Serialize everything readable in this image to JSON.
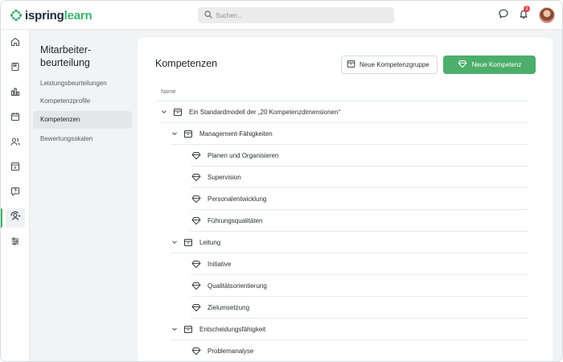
{
  "brand": {
    "part1": "ispring",
    "part2": "learn"
  },
  "search": {
    "placeholder": "Suchen..."
  },
  "notifications": {
    "count": "1"
  },
  "rail": {
    "icons": [
      "home-icon",
      "book-icon",
      "chart-icon",
      "calendar-icon",
      "users-icon",
      "archive-icon",
      "help-icon",
      "review-icon",
      "settings-icon"
    ],
    "active": "review-icon"
  },
  "subnav": {
    "title": "Mitarbeiter-beurteilung",
    "items": [
      {
        "label": "Leistungsbeurteilungen",
        "active": false
      },
      {
        "label": "Kompetenzprofile",
        "active": false
      },
      {
        "label": "Kompetenzen",
        "active": true
      },
      {
        "label": "Bewertungsskalen",
        "active": false
      }
    ]
  },
  "main": {
    "title": "Kompetenzen",
    "new_group_button": "Neue Kompetenzgruppe",
    "new_competency_button": "Neue Kompetenz",
    "accent_color": "#4cae6a",
    "column_name": "Name",
    "rows": [
      {
        "label": "Ein Standardmodell der „20 Kompetenzdimensionen“",
        "kind": "group",
        "level": 0
      },
      {
        "label": "Management-Fähigkeiten",
        "kind": "group",
        "level": 1
      },
      {
        "label": "Planen und Organisieren",
        "kind": "competency",
        "level": 2
      },
      {
        "label": "Supervision",
        "kind": "competency",
        "level": 2
      },
      {
        "label": "Personalentwicklung",
        "kind": "competency",
        "level": 2
      },
      {
        "label": "Führungsqualitäten",
        "kind": "competency",
        "level": 2
      },
      {
        "label": "Leitung",
        "kind": "group",
        "level": 1
      },
      {
        "label": "Initiative",
        "kind": "competency",
        "level": 2
      },
      {
        "label": "Qualitätsorientierung",
        "kind": "competency",
        "level": 2
      },
      {
        "label": "Zielumsetzung",
        "kind": "competency",
        "level": 2
      },
      {
        "label": "Entscheidungsfähigkeit",
        "kind": "group",
        "level": 1
      },
      {
        "label": "Problemanalyse",
        "kind": "competency",
        "level": 2
      }
    ]
  }
}
